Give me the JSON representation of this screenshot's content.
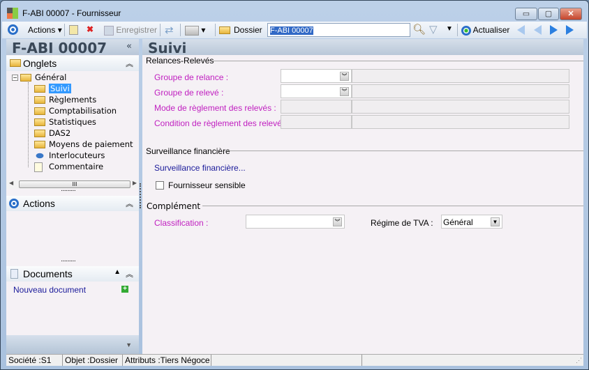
{
  "window": {
    "title": "F-ABI 00007 -  Fournisseur",
    "minimize": "▭",
    "maximize": "▢",
    "close": "✕"
  },
  "toolbar": {
    "actions": "Actions",
    "save": "Enregistrer",
    "folder": "Dossier",
    "search_value": "F-ABI 00007",
    "refresh": "Actualiser"
  },
  "left": {
    "header": "F-ABI 00007",
    "collapse": "«",
    "onglets": "Onglets",
    "tree_root": "Général",
    "tree": [
      "Suivi",
      "Règlements",
      "Comptabilisation",
      "Statistiques",
      "DAS2",
      "Moyens de paiement",
      "Interlocuteurs",
      "Commentaire"
    ],
    "scroll_grip": "III",
    "actions": "Actions",
    "documents": "Documents",
    "new_document": "Nouveau document"
  },
  "main": {
    "header": "Suivi",
    "group1": "Relances-Relevés",
    "fields1": [
      "Groupe de relance :",
      "Groupe de relevé :",
      "Mode de règlement des relevés :",
      "Condition de règlement des relevés :"
    ],
    "group2": "Surveillance financière",
    "link": "Surveillance financière...",
    "checkbox": "Fournisseur sensible",
    "checkbox_checked": false,
    "group3": "Complément",
    "classification": "Classification :",
    "tva_label": "Régime de TVA :",
    "tva_value": "Général"
  },
  "status": {
    "societe": "Société :S1",
    "objet": "Objet :Dossier",
    "attributs": "Attributs :Tiers Négoce"
  }
}
